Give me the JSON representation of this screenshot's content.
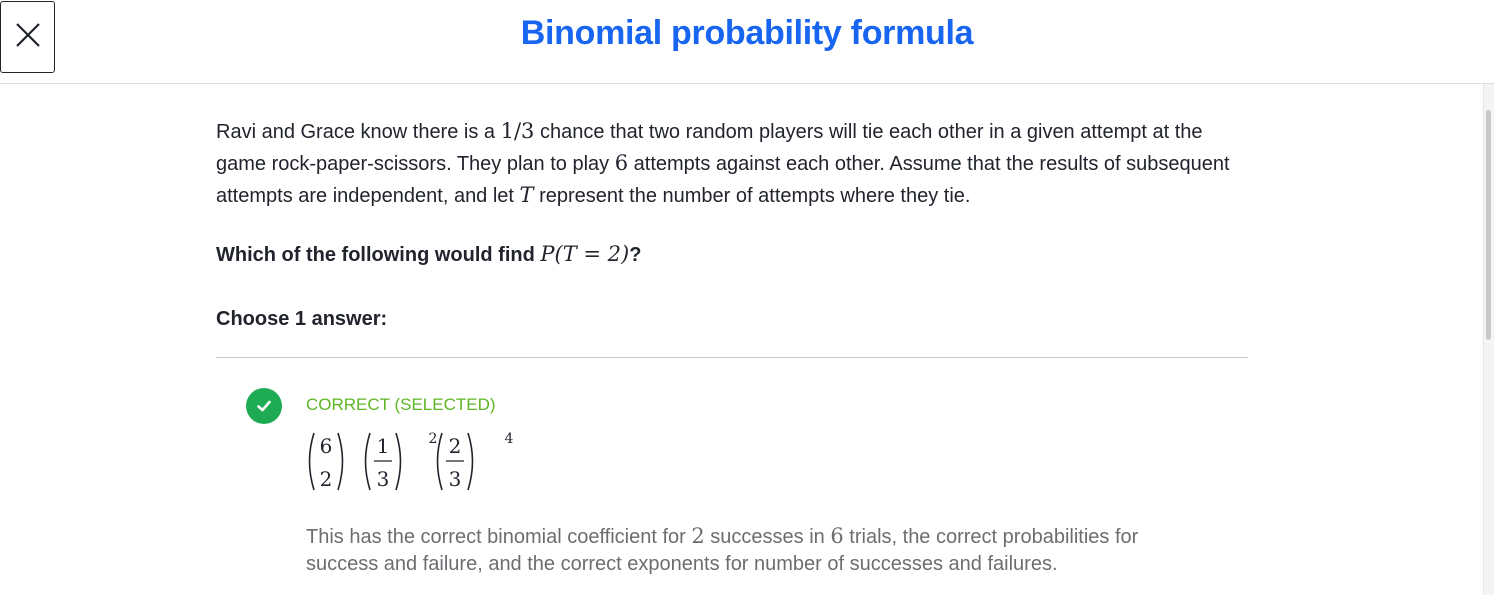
{
  "header": {
    "title": "Binomial probability formula",
    "close_icon": "close-icon"
  },
  "problem": {
    "t1": "Ravi and Grace know there is a ",
    "m1": "1/3",
    "t2": " chance that two random players will tie each other in a given attempt at the game rock-paper-scissors. They plan to play ",
    "m2": "6",
    "t3": " attempts against each other. Assume that the results of subsequent attempts are independent, and let ",
    "m3": "T",
    "t4": " represent the number of attempts where they tie."
  },
  "question": {
    "t1": "Which of the following would find ",
    "m1": "P(T = 2)",
    "t2": "?"
  },
  "choose_label": "Choose 1 answer:",
  "answer": {
    "status": "CORRECT (SELECTED)",
    "formula": {
      "binom_top": "6",
      "binom_bottom": "2",
      "frac1_num": "1",
      "frac1_den": "3",
      "exp1": "2",
      "frac2_num": "2",
      "frac2_den": "3",
      "exp2": "4"
    },
    "explanation": {
      "t1": "This has the correct binomial coefficient for ",
      "m1": "2",
      "t2": " successes in ",
      "m2": "6",
      "t3": " trials, the correct probabilities for success and failure, and the correct exponents for number of successes and failures."
    }
  },
  "colors": {
    "title": "#1865f2",
    "correct_green": "#1fab54",
    "status_green": "#5eb526"
  }
}
